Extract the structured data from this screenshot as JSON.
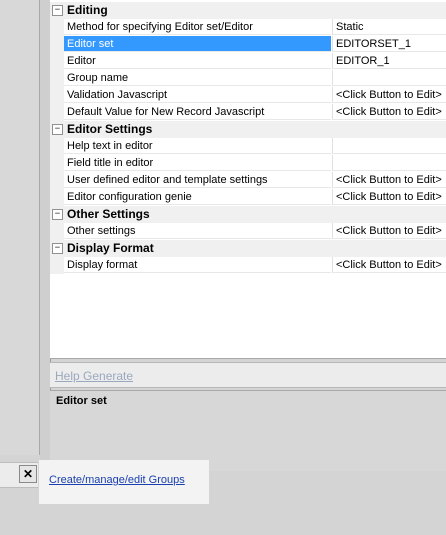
{
  "property_grid": {
    "categories": [
      {
        "label": "Editing",
        "properties": [
          {
            "name": "Method for specifying Editor set/Editor",
            "value": "Static"
          },
          {
            "name": "Editor set",
            "value": "EDITORSET_1",
            "selected": true
          },
          {
            "name": "Editor",
            "value": "EDITOR_1"
          },
          {
            "name": "Group name",
            "value": ""
          },
          {
            "name": "Validation Javascript",
            "value": "<Click Button to Edit>"
          },
          {
            "name": "Default Value for New Record Javascript",
            "value": "<Click Button to Edit>"
          }
        ]
      },
      {
        "label": "Editor Settings",
        "properties": [
          {
            "name": "Help text in editor",
            "value": ""
          },
          {
            "name": "Field title in editor",
            "value": ""
          },
          {
            "name": "User defined editor and template settings",
            "value": "<Click Button to Edit>"
          },
          {
            "name": "Editor configuration genie",
            "value": "<Click Button to Edit>"
          }
        ]
      },
      {
        "label": "Other Settings",
        "properties": [
          {
            "name": "Other settings",
            "value": "<Click Button to Edit>"
          }
        ]
      },
      {
        "label": "Display Format",
        "properties": [
          {
            "name": "Display format",
            "value": "<Click Button to Edit>"
          }
        ]
      }
    ]
  },
  "help_bar": {
    "link": "Help Generate"
  },
  "description": {
    "title": "Editor set"
  },
  "bottom": {
    "close_label": "✕",
    "groups_link": "Create/manage/edit Groups"
  }
}
